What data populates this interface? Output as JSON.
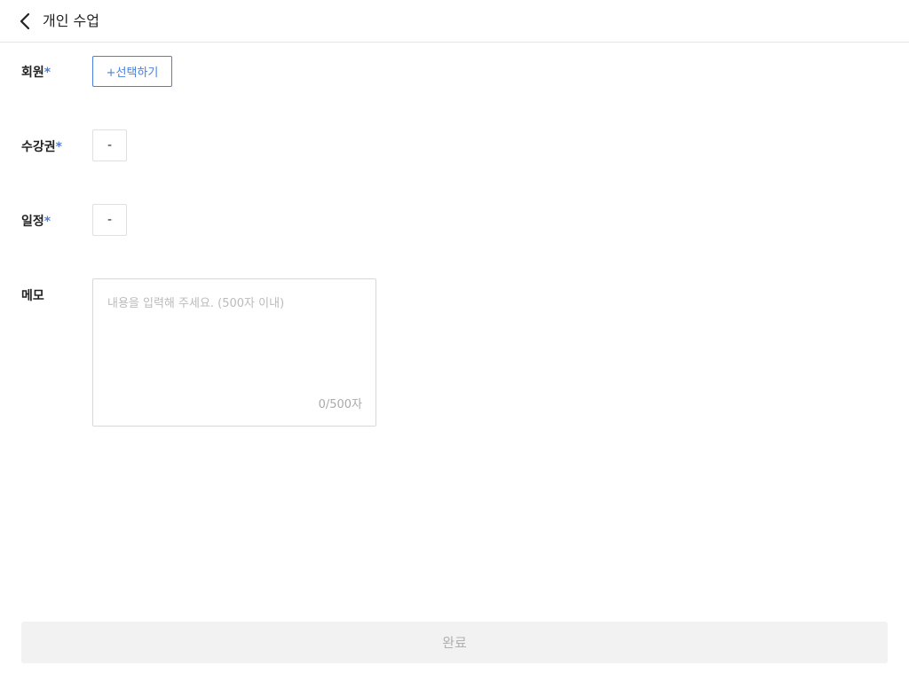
{
  "header": {
    "back_icon": "chevron-left-icon",
    "title": "개인 수업"
  },
  "form": {
    "member": {
      "label": "회원",
      "required_mark": "*",
      "select_label": "+선택하기"
    },
    "ticket": {
      "label": "수강권",
      "required_mark": "*",
      "value": "-"
    },
    "schedule": {
      "label": "일정",
      "required_mark": "*",
      "value": "-"
    },
    "memo": {
      "label": "메모",
      "placeholder": "내용을 입력해 주세요. (500자 이내)",
      "value": "",
      "counter": "0/500자"
    }
  },
  "footer": {
    "complete_label": "완료"
  },
  "colors": {
    "accent": "#4a7fe0",
    "disabled_bg": "#f2f2f2",
    "disabled_text": "#b0b0b0"
  }
}
